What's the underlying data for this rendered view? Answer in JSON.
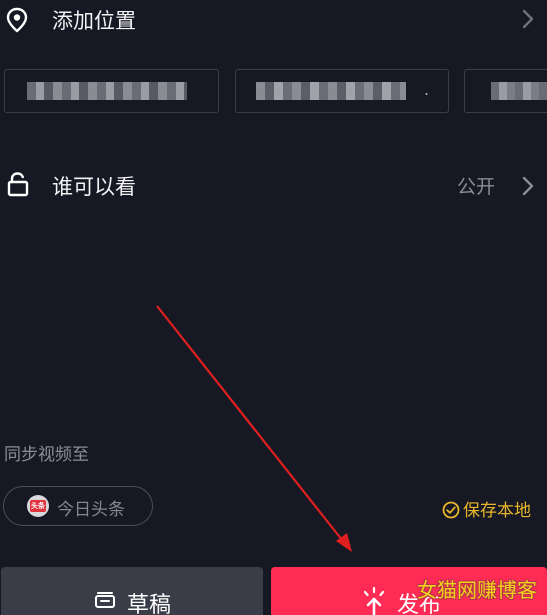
{
  "location": {
    "label": "添加位置"
  },
  "location_chips": [
    {
      "text": "░░░░░░░░░░░"
    },
    {
      "text": "░░░░░░░░░░░."
    },
    {
      "text": "░░░░"
    }
  ],
  "privacy": {
    "label": "谁可以看",
    "value": "公开"
  },
  "sync": {
    "title": "同步视频至",
    "toutiao_label": "今日头条",
    "toutiao_logo_text": "头条"
  },
  "save_local": {
    "label": "保存本地"
  },
  "buttons": {
    "draft_label": "草稿",
    "publish_label": "发布"
  },
  "watermark": {
    "text": "女猫网赚博客"
  },
  "colors": {
    "background": "#161823",
    "publish": "#fe2c55",
    "draft": "#3a3c47",
    "save_local": "#e8b62a",
    "annotation_arrow": "#e02020"
  },
  "icons": {
    "location": "location-pin-icon",
    "privacy": "unlock-icon",
    "chevron": "chevron-right-icon",
    "save_local": "check-circle-icon",
    "draft": "draft-box-icon",
    "publish": "publish-sparkle-icon"
  }
}
